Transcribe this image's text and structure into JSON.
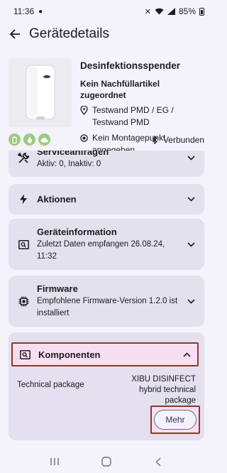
{
  "status_bar": {
    "time": "11:36",
    "battery": "85%"
  },
  "header": {
    "title": "Gerätedetails"
  },
  "device": {
    "name": "Desinfektionsspender",
    "refill": "Kein Nachfüllartikel zugeordnet",
    "location": "Testwand PMD / EG / Testwand PMD",
    "mount": "Kein Montagepunkt angegeben",
    "connection": "Verbunden"
  },
  "cards": {
    "service": {
      "title": "Serviceanfragen",
      "subtitle": "Aktiv: 0, Inaktiv: 0"
    },
    "actions": {
      "title": "Aktionen"
    },
    "device_info": {
      "title": "Geräteinformation",
      "subtitle": "Zuletzt Daten empfangen 26.08.24, 11:32"
    },
    "firmware": {
      "title": "Firmware",
      "subtitle": "Empfohlene Firmware-Version 1.2.0 ist installiert"
    },
    "components": {
      "title": "Komponenten",
      "label": "Technical package",
      "value": "XIBU DISINFECT hybrid technical package",
      "more_label": "Mehr"
    }
  },
  "colors": {
    "accent": "#8a3a2c",
    "card": "#e3e1ee",
    "badge": "#9ccb7f"
  }
}
